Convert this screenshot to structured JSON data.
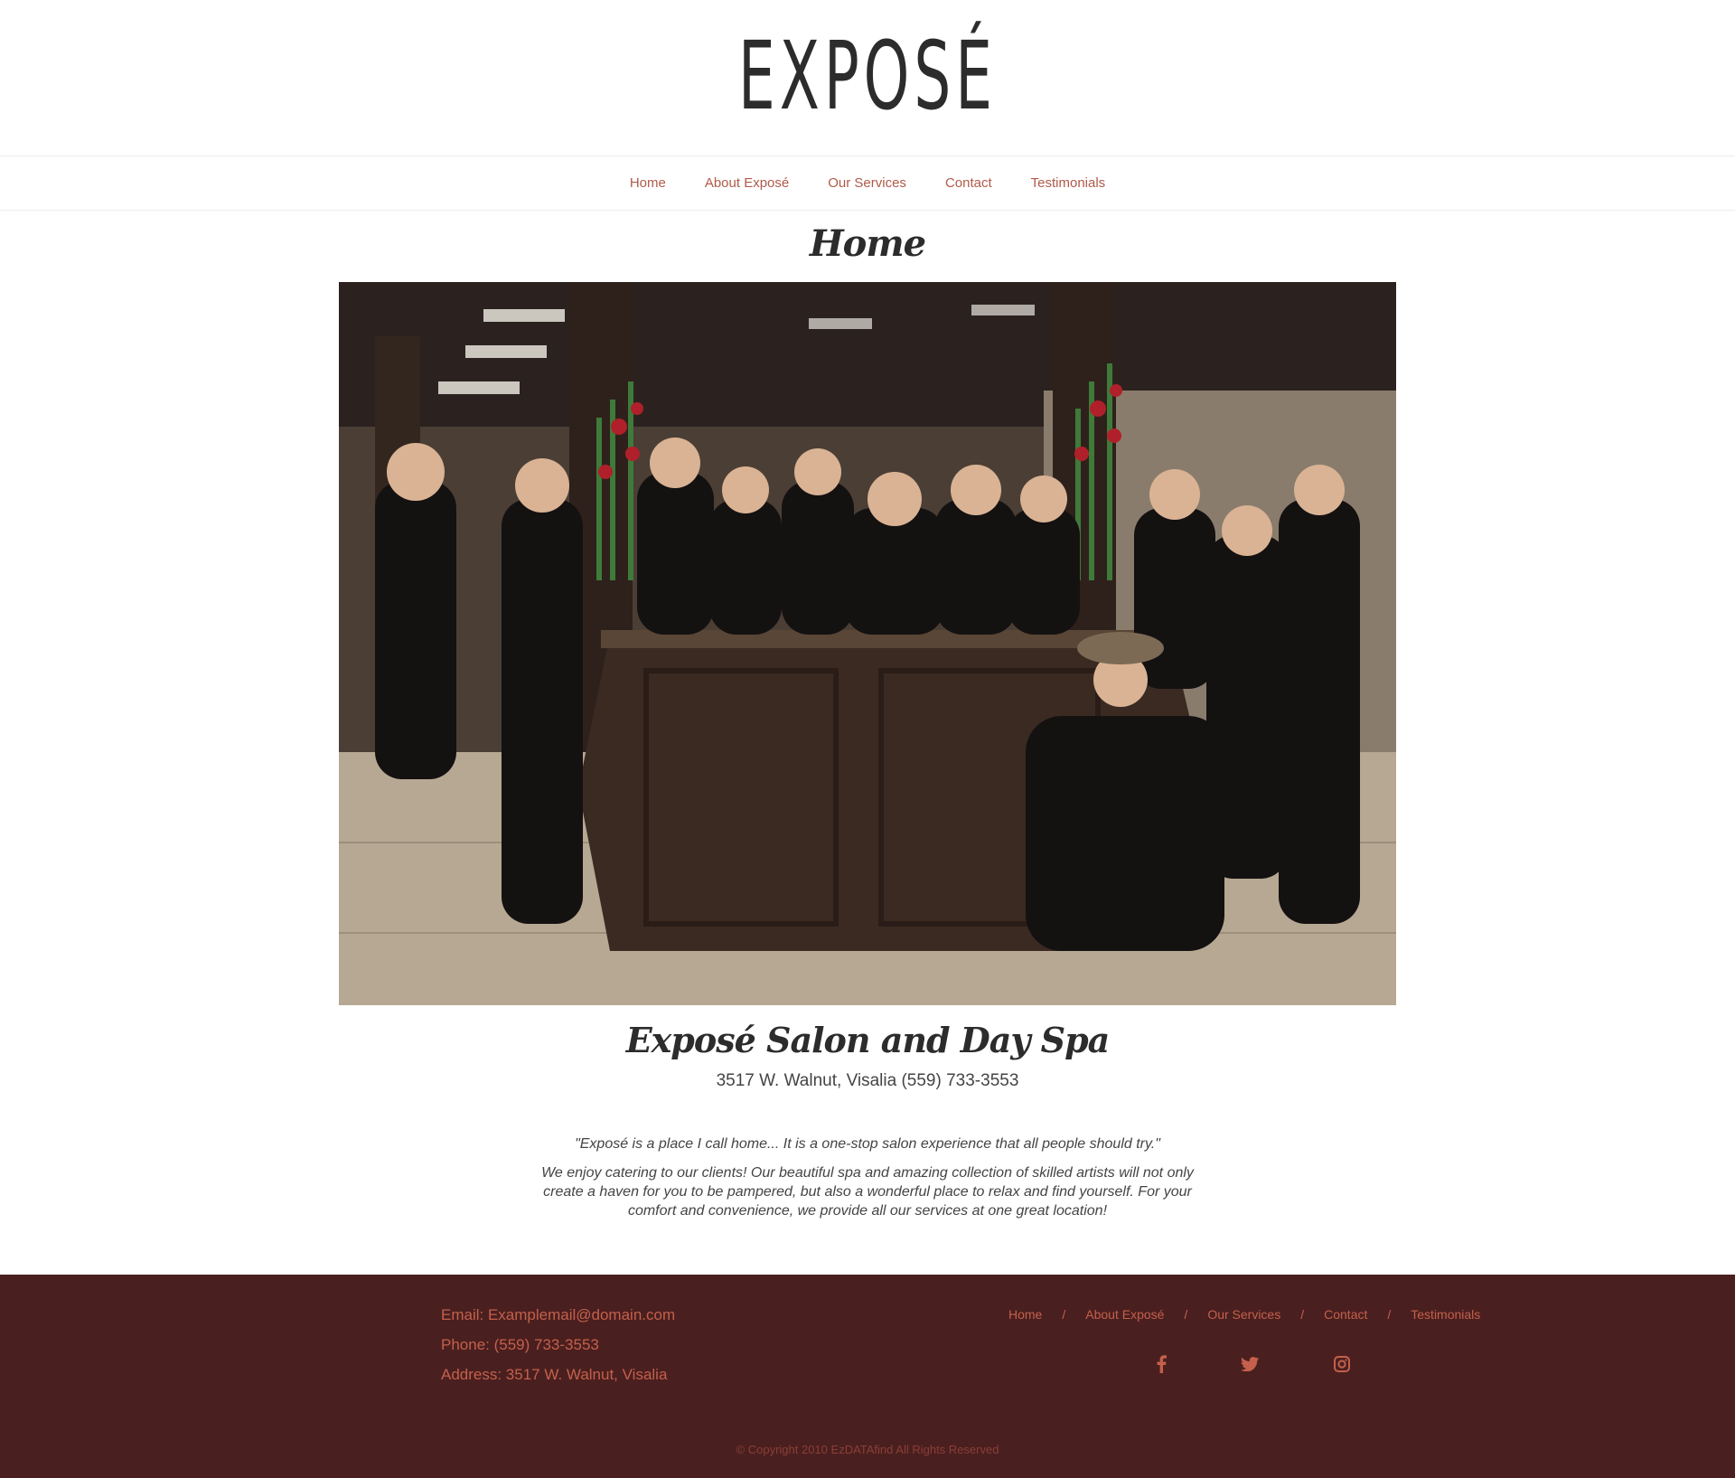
{
  "header": {
    "logo_text": "EXPOSÉ"
  },
  "nav": {
    "items": [
      {
        "label": "Home"
      },
      {
        "label": "About Exposé"
      },
      {
        "label": "Our Services"
      },
      {
        "label": "Contact"
      },
      {
        "label": "Testimonials"
      }
    ]
  },
  "main": {
    "page_title": "Home",
    "salon_title": "Exposé Salon and Day Spa",
    "address_line": "3517 W. Walnut, Visalia (559) 733-3553",
    "quote": "\"Exposé is a place I call home... It is a one-stop salon experience that all people should try.\"",
    "description": "We enjoy catering to our clients! Our beautiful spa and amazing collection of skilled artists will not only create a haven for you to be pampered, but also a wonderful place to relax and find yourself. For your comfort and convenience, we provide all our services at one great location!"
  },
  "footer": {
    "email": "Email: Examplemail@domain.com",
    "phone": "Phone: (559) 733-3553",
    "address": "Address: 3517 W. Walnut, Visalia",
    "nav": [
      {
        "label": "Home"
      },
      {
        "label": "About Exposé"
      },
      {
        "label": "Our Services"
      },
      {
        "label": "Contact"
      },
      {
        "label": "Testimonials"
      }
    ],
    "separator": "/",
    "social_icons": [
      "facebook-icon",
      "twitter-icon",
      "instagram-icon"
    ],
    "copyright": "© Copyright 2010 EzDATAfind All Rights Reserved"
  },
  "colors": {
    "accent": "#c4604c",
    "nav_link": "#b05a4a",
    "footer_bg": "#4a1f1f",
    "text_dark": "#2c2c2c"
  }
}
